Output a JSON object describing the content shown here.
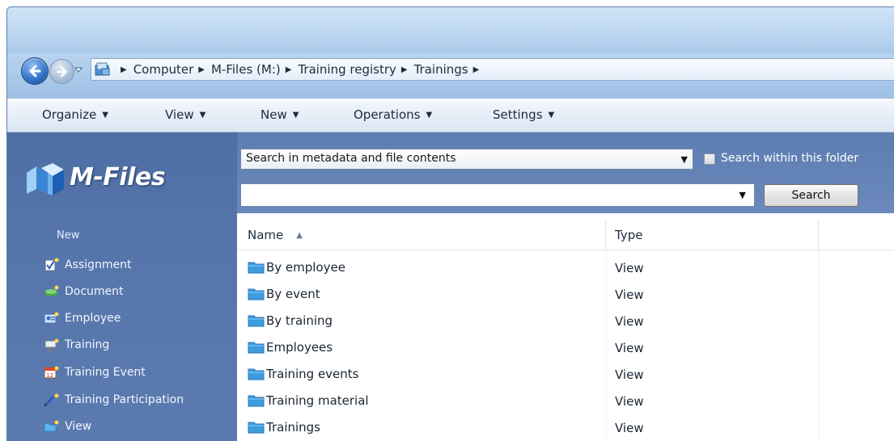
{
  "breadcrumb": [
    "Computer",
    "M-Files (M:)",
    "Training registry",
    "Trainings"
  ],
  "toolbar": [
    {
      "label": "Organize"
    },
    {
      "label": "View"
    },
    {
      "label": "New"
    },
    {
      "label": "Operations"
    },
    {
      "label": "Settings"
    }
  ],
  "sidebar": {
    "logo_text": "M-Files",
    "new_label": "New",
    "items": [
      {
        "label": "Assignment",
        "icon": "assignment-icon"
      },
      {
        "label": "Document",
        "icon": "document-icon"
      },
      {
        "label": "Employee",
        "icon": "employee-icon"
      },
      {
        "label": "Training",
        "icon": "training-icon"
      },
      {
        "label": "Training Event",
        "icon": "calendar-icon"
      },
      {
        "label": "Training Participation",
        "icon": "pen-icon"
      },
      {
        "label": "View",
        "icon": "folder-icon"
      }
    ]
  },
  "search": {
    "mode": "Search in metadata and file contents",
    "within_label": "Search within this folder",
    "query": "",
    "button_label": "Search"
  },
  "list": {
    "columns": {
      "name": "Name",
      "type": "Type"
    },
    "rows": [
      {
        "name": "By employee",
        "type": "View"
      },
      {
        "name": "By event",
        "type": "View"
      },
      {
        "name": "By training",
        "type": "View"
      },
      {
        "name": "Employees",
        "type": "View"
      },
      {
        "name": "Training events",
        "type": "View"
      },
      {
        "name": "Training material",
        "type": "View"
      },
      {
        "name": "Trainings",
        "type": "View"
      }
    ]
  },
  "colors": {
    "sidebar_bg": "#5676ab",
    "folder_blue": "#3d9de0",
    "toolbar_bg": "#e6eef8"
  }
}
